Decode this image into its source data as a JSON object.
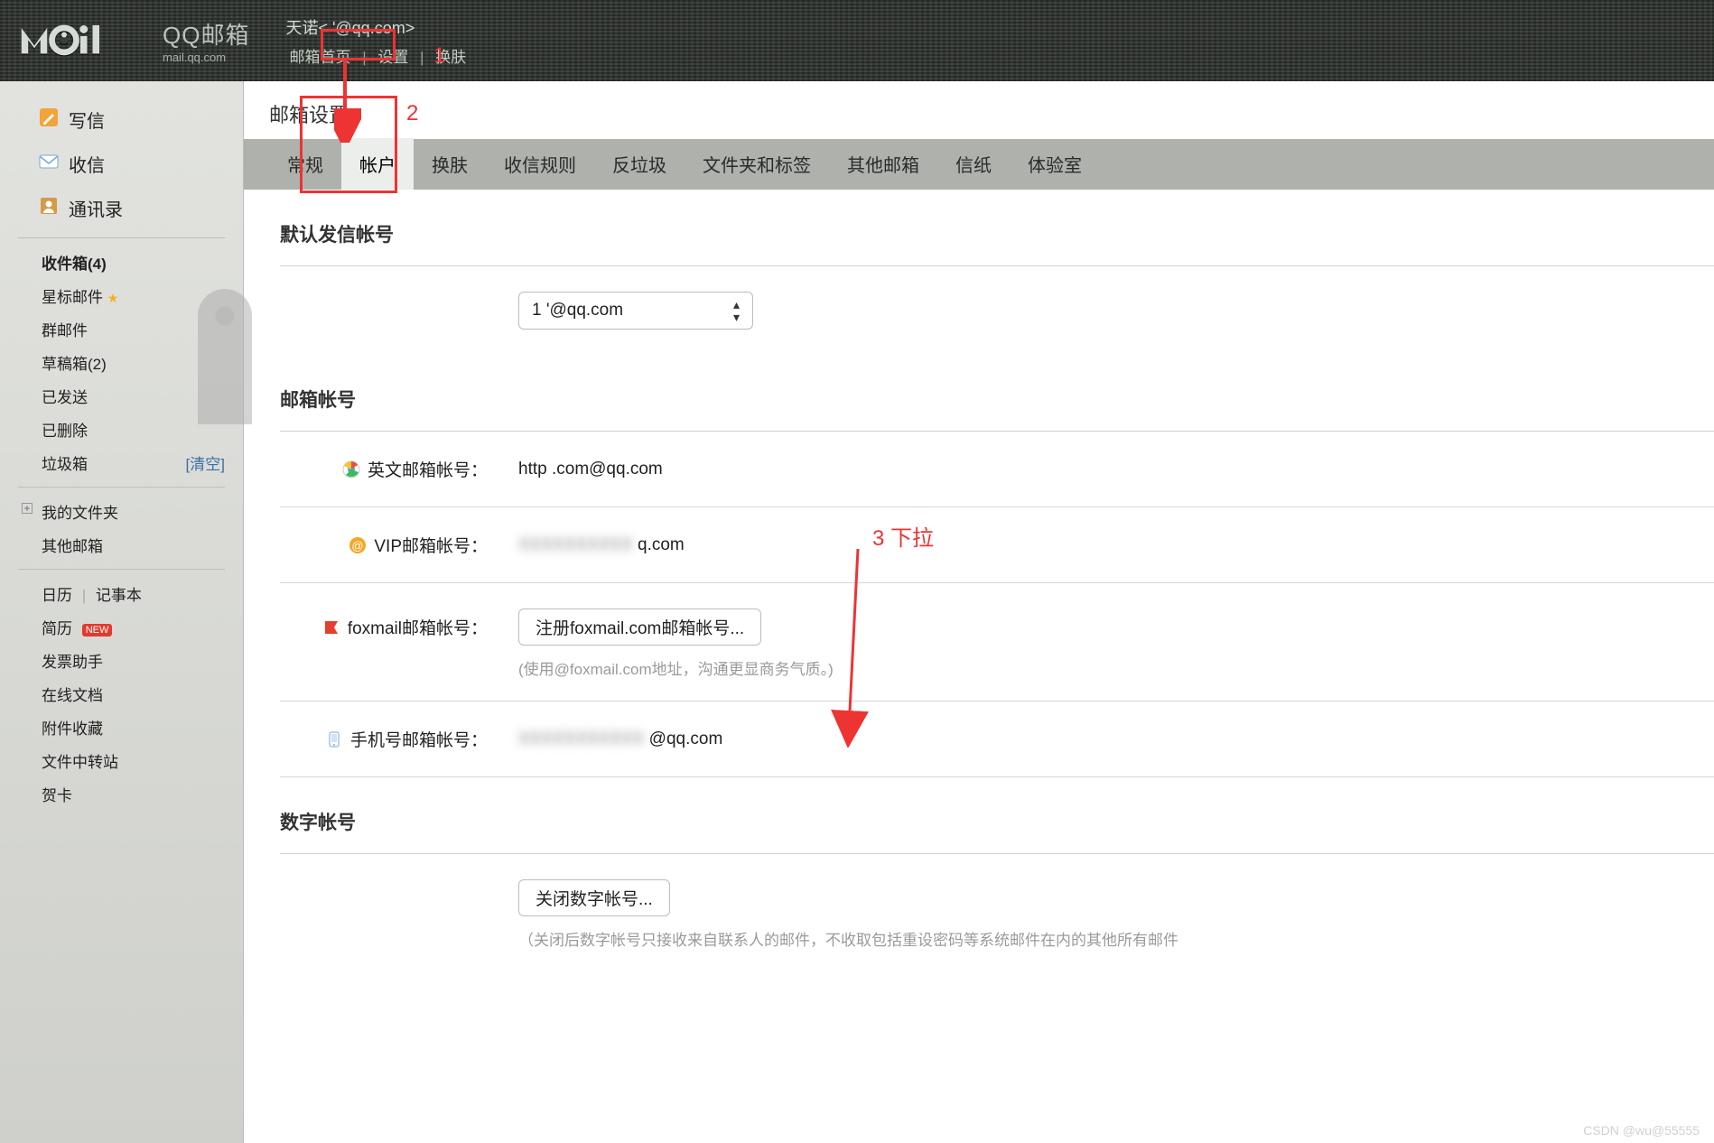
{
  "header": {
    "logo_cn": "QQ邮箱",
    "logo_en": "mail.qq.com",
    "user_display": "天诺<                      '@qq.com>",
    "nav": {
      "home": "邮箱首页",
      "settings": "设置",
      "skin": "换肤"
    }
  },
  "sidebar": {
    "compose": "写信",
    "receive": "收信",
    "contacts": "通讯录",
    "inbox": "收件箱(4)",
    "starred": "星标邮件",
    "group": "群邮件",
    "drafts": "草稿箱(2)",
    "sent": "已发送",
    "deleted": "已删除",
    "trash": "垃圾箱",
    "trash_action": "[清空]",
    "myfolders": "我的文件夹",
    "othermail": "其他邮箱",
    "calendar": "日历",
    "notes": "记事本",
    "resume": "简历",
    "resume_badge": "NEW",
    "invoice": "发票助手",
    "docs": "在线文档",
    "attachments": "附件收藏",
    "transfer": "文件中转站",
    "cards": "贺卡"
  },
  "main": {
    "title": "邮箱设置",
    "tabs": [
      "常规",
      "帐户",
      "换肤",
      "收信规则",
      "反垃圾",
      "文件夹和标签",
      "其他邮箱",
      "信纸",
      "体验室"
    ],
    "active_tab_index": 1,
    "sections": {
      "default_sender": {
        "title": "默认发信帐号",
        "selector_value": "1                    '@qq.com"
      },
      "accounts": {
        "title": "邮箱帐号",
        "english_label": "英文邮箱帐号：",
        "english_value": "http                    .com@qq.com",
        "vip_label": "VIP邮箱帐号：",
        "vip_value": "                    q.com",
        "foxmail_label": "foxmail邮箱帐号：",
        "foxmail_button": "注册foxmail.com邮箱帐号...",
        "foxmail_hint": "(使用@foxmail.com地址，沟通更显商务气质。)",
        "mobile_label": "手机号邮箱帐号：",
        "mobile_value": "                        @qq.com"
      },
      "numeric": {
        "title": "数字帐号",
        "close_button": "关闭数字帐号...",
        "hint_partial": "（关闭后数字帐号只接收来自联系人的邮件，不收取包括重设密码等系统邮件在内的其他所有邮件"
      }
    }
  },
  "annotations": {
    "n1": "1",
    "n2": "2",
    "n3": "3 下拉"
  },
  "watermark": "CSDN @wu@55555"
}
